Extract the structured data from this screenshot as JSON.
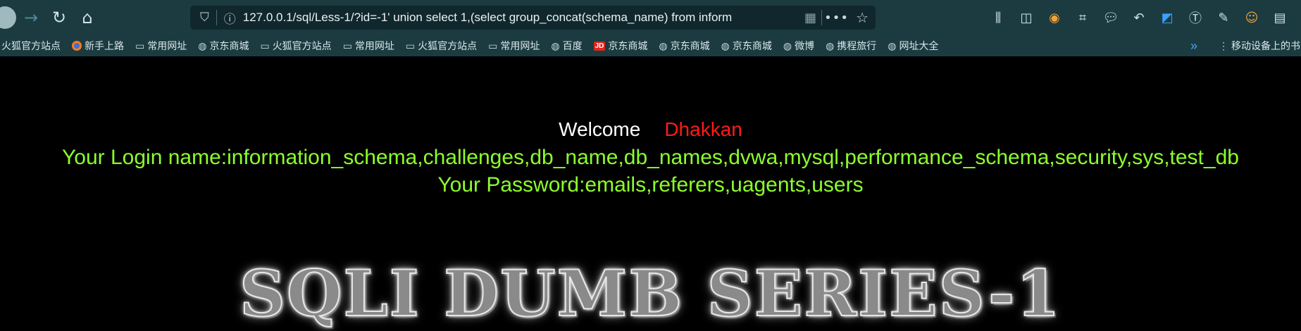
{
  "browser": {
    "url": "127.0.0.1/sql/Less-1/?id=-1' union select 1,(select group_concat(schema_name) from inform",
    "bookmarks": [
      {
        "label": "火狐官方站点",
        "icon": "none"
      },
      {
        "label": "新手上路",
        "icon": "firefox-icon"
      },
      {
        "label": "常用网址",
        "icon": "folder-icon"
      },
      {
        "label": "京东商城",
        "icon": "globe-icon"
      },
      {
        "label": "火狐官方站点",
        "icon": "folder-icon"
      },
      {
        "label": "常用网址",
        "icon": "folder-icon"
      },
      {
        "label": "火狐官方站点",
        "icon": "folder-icon"
      },
      {
        "label": "常用网址",
        "icon": "folder-icon"
      },
      {
        "label": "百度",
        "icon": "globe-icon"
      },
      {
        "label": "京东商城",
        "icon": "jd-icon"
      },
      {
        "label": "京东商城",
        "icon": "globe-icon"
      },
      {
        "label": "京东商城",
        "icon": "globe-icon"
      },
      {
        "label": "微博",
        "icon": "globe-icon"
      },
      {
        "label": "携程旅行",
        "icon": "globe-icon"
      },
      {
        "label": "网址大全",
        "icon": "globe-icon"
      }
    ],
    "mobile_bookmarks": "移动设备上的书",
    "jd_badge": "JD"
  },
  "page": {
    "welcome": "Welcome",
    "name": "Dhakkan",
    "login": "Your Login name:information_schema,challenges,db_name,db_names,dvwa,mysql,performance_schema,security,sys,test_db",
    "password": "Your Password:emails,referers,uagents,users",
    "banner": "SQLI DUMB SERIES-1"
  },
  "colors": {
    "chrome": "#1c3b41",
    "welcome": "#ffffff",
    "name": "#ff1a1a",
    "result": "#8cff2c",
    "background": "#000000"
  }
}
